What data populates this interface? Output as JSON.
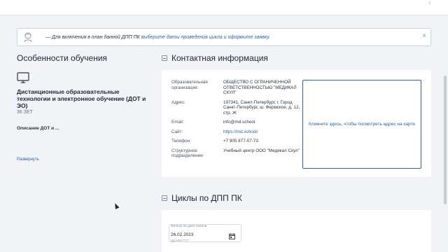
{
  "notice": {
    "prefix": "— Для включения в план данной ДПП ПК ",
    "link": "выберите даты проведения цикла и оформите заявку.",
    "close": "×"
  },
  "topbar": {
    "corner_mark": "×"
  },
  "features": {
    "title": "Особенности обучения",
    "course_title": "Дистанционные образовательные технологии и электронное обучение (ДОТ и ЭО)",
    "credits": "36 ЗЕТ",
    "description": "Описание ДОТ и ...",
    "expand_label": "Развернуть"
  },
  "contact": {
    "title": "Контактная информация",
    "rows": [
      {
        "key": "Образовательная организация:",
        "value": "ОБЩЕСТВО С ОГРАНИЧЕННОЙ ОТВЕТСТВЕННОСТЬЮ \"МЕДИКАЛ СКУЛ\""
      },
      {
        "key": "Адрес:",
        "value": "197341, Санкт-Петербург, г. Город Санкт-Петербург, ш. Фермское, д. 12, стр. Ж"
      },
      {
        "key": "Email:",
        "value": "info@md.school"
      },
      {
        "key": "Сайт:",
        "value": "https://md.school/"
      },
      {
        "key": "Телефон:",
        "value": "+7 905 877-07-73"
      },
      {
        "key": "Структурное подразделение:",
        "value": "Учебный центр ООО \"Медикал Скул\""
      }
    ],
    "map_link": "Кликните здесь, чтобы посмотреть адрес на карте"
  },
  "cycles": {
    "title": "Циклы по ДПП ПК",
    "filter": {
      "label": "Фильтр по дате начала",
      "value": "26.02.2023",
      "hint": "ДД.ММ.ГГГГ"
    }
  },
  "colors": {
    "accent": "#2a63a8",
    "background": "#f1f3f6",
    "card": "#ffffff"
  }
}
